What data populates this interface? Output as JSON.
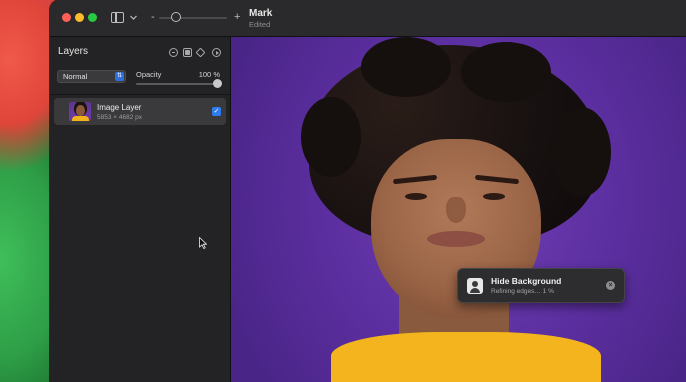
{
  "window": {
    "doc_title": "Mark",
    "doc_subtitle": "Edited",
    "zoom_minus_glyph": "-",
    "zoom_plus_glyph": "+",
    "zoom_level": 0.2
  },
  "sidebar": {
    "title": "Layers",
    "header_icons": [
      "minus-circle-icon",
      "mask-icon",
      "layers-stack-icon",
      "play-circle-icon"
    ],
    "blend_mode": "Normal",
    "opacity_label": "Opacity",
    "opacity_value": "100 %",
    "opacity_level": 1.0,
    "layers": [
      {
        "name": "Image Layer",
        "size": "5853 × 4682 px",
        "visible": true
      }
    ]
  },
  "toast": {
    "title": "Hide Background",
    "subtitle": "Refining edges… 1 %",
    "icon": "person-silhouette-icon",
    "progress_percent": 1
  },
  "colors": {
    "accent": "#2f7bf0",
    "canvas_background": "#5c2fa0",
    "shirt": "#f4b41e"
  }
}
